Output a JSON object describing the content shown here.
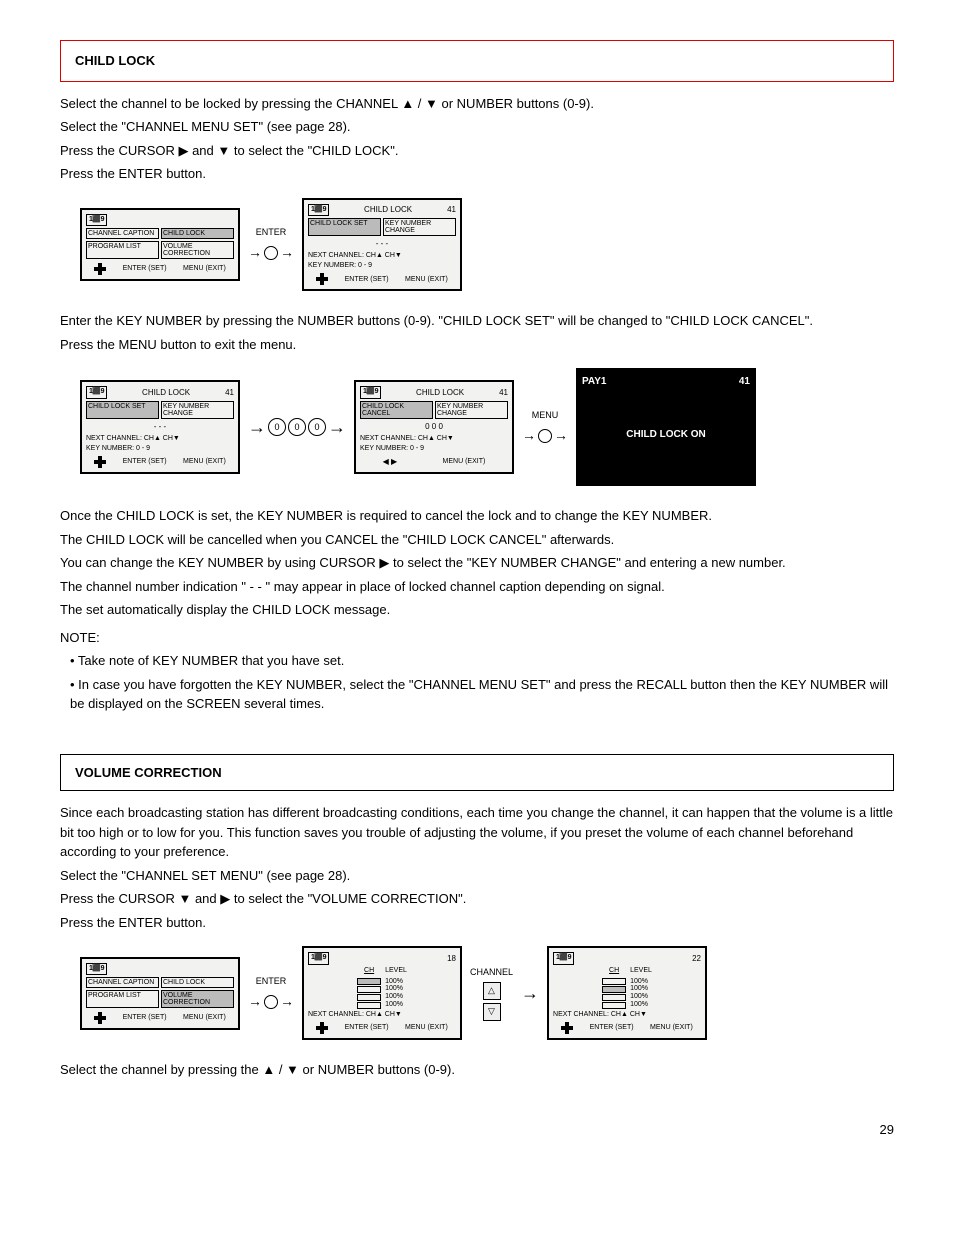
{
  "titles": {
    "child_lock": "CHILD LOCK",
    "volume_correction": "VOLUME CORRECTION"
  },
  "instructions": {
    "cl1": "Select the channel to be locked by pressing the CHANNEL ▲ / ▼ or NUMBER buttons (0-9).",
    "cl2": "Select the \"CHANNEL MENU SET\" (see page 28).",
    "cl3": "Press the CURSOR ▶ and ▼ to select the \"CHILD LOCK\".",
    "cl4": "Press the ENTER button.",
    "cl5": "Enter the KEY NUMBER by pressing the NUMBER buttons (0-9). \"CHILD LOCK SET\" will be changed to \"CHILD LOCK CANCEL\".",
    "cl6": "Press the MENU button to exit the menu.",
    "cl_note1": "Once the CHILD LOCK is set, the KEY NUMBER is required to cancel the lock and to change the KEY NUMBER.",
    "cl_note2": "The CHILD LOCK will be cancelled when you CANCEL the \"CHILD LOCK CANCEL\" afterwards.",
    "cl_note3": "You can change the KEY NUMBER by using CURSOR ▶ to select the \"KEY NUMBER CHANGE\" and entering a new number.",
    "cl_note4": "The channel number indication \" - - \" may appear in place of locked channel caption depending on signal.",
    "cl_note5": "The set automatically display the CHILD LOCK message.",
    "cl_note_title": "NOTE:",
    "cl_note_a": "• Take note of KEY NUMBER that you have set.",
    "cl_note_b": "• In case you have forgotten the KEY NUMBER, select the \"CHANNEL MENU SET\" and press the RECALL button then the KEY NUMBER will be displayed on the SCREEN several times.",
    "vc_intro": "Since each broadcasting station has different broadcasting conditions, each time you change the channel, it can happen that the volume is a little bit too high or to low for you. This function saves you trouble of adjusting the volume, if you preset the volume of each channel beforehand according to your preference.",
    "vc1": "Select the \"CHANNEL SET MENU\" (see page 28).",
    "vc2": "Press the CURSOR ▼ and ▶ to select the \"VOLUME CORRECTION\".",
    "vc3": "Press the ENTER button.",
    "vc4": "Select the channel by pressing the ▲ / ▼ or NUMBER buttons (0-9)."
  },
  "screens": {
    "menu": {
      "icon": "1⬛9",
      "buttons": [
        [
          "CHANNEL CAPTION",
          "CHILD LOCK"
        ],
        [
          "PROGRAM LIST",
          "VOLUME CORRECTION"
        ]
      ],
      "footer": {
        "enter": "ENTER (SET)",
        "menu": "MENU (EXIT)"
      }
    },
    "childlock_a": {
      "title": "CHILD LOCK",
      "ch": "41",
      "buttons": [
        "CHILD LOCK SET",
        "KEY NUMBER CHANGE"
      ],
      "dots": "- - -",
      "line1": "NEXT CHANNEL: CH▲ CH▼",
      "line2": "KEY NUMBER: 0 - 9",
      "footer": {
        "enter": "ENTER (SET)",
        "menu": "MENU (EXIT)"
      }
    },
    "childlock_b": {
      "title": "CHILD LOCK",
      "ch": "41",
      "buttons": [
        "CHILD LOCK CANCEL",
        "KEY NUMBER CHANGE"
      ],
      "dots": "0 0 0",
      "line1": "NEXT CHANNEL: CH▲ CH▼",
      "line2": "KEY NUMBER: 0 - 9",
      "footer": {
        "enter": "◀ ▶",
        "menu": "MENU (EXIT)"
      }
    },
    "final": {
      "left": "PAY1",
      "right": "41",
      "msg": "CHILD LOCK ON"
    },
    "vol_a": {
      "ch": "18",
      "head_ch": "CH",
      "head_lv": "LEVEL",
      "levels": [
        "100%",
        "100%",
        "100%",
        "100%"
      ],
      "line1": "NEXT CHANNEL: CH▲ CH▼",
      "footer": {
        "enter": "ENTER (SET)",
        "menu": "MENU (EXIT)"
      }
    },
    "vol_b": {
      "ch": "22",
      "head_ch": "CH",
      "head_lv": "LEVEL",
      "levels": [
        "100%",
        "100%",
        "100%",
        "100%"
      ],
      "line1": "NEXT CHANNEL: CH▲ CH▼",
      "footer": {
        "enter": "ENTER (SET)",
        "menu": "MENU (EXIT)"
      }
    }
  },
  "labels": {
    "enter": "ENTER",
    "menu": "MENU",
    "channel": "CHANNEL",
    "zero": "0"
  },
  "page": "29"
}
